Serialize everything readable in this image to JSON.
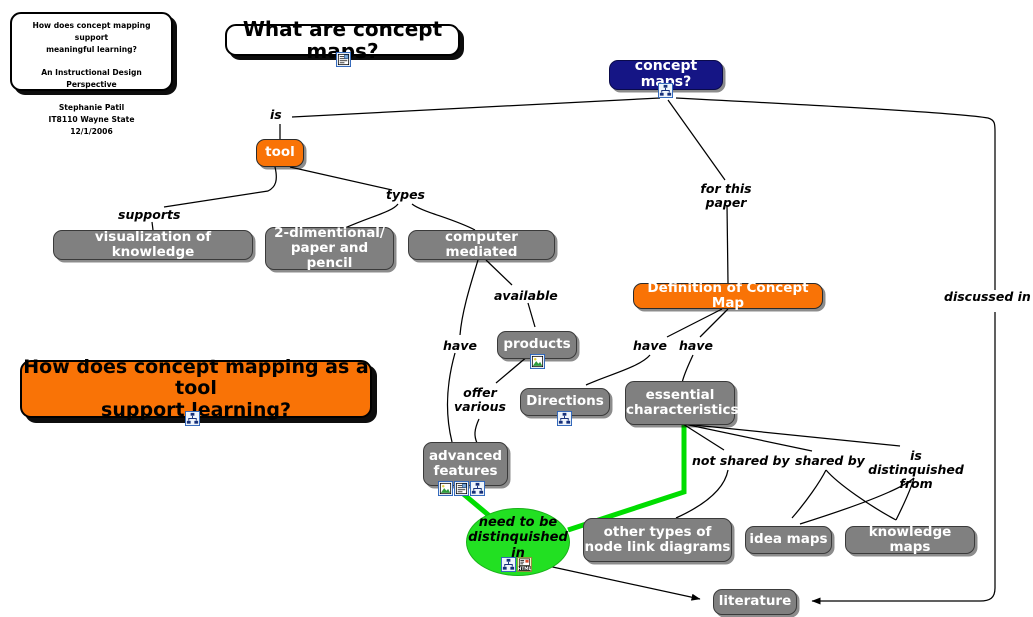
{
  "document": {
    "type": "concept-map",
    "background": "#ffffff"
  },
  "colors": {
    "grey_node": "#808080",
    "orange_node": "#f97306",
    "navy_node": "#151585",
    "green_ellipse": "#22e022",
    "green_link": "#00dd00",
    "white_node": "#ffffff",
    "text_on_grey": "#ffffff",
    "line": "#000000"
  },
  "title_card": {
    "line1": "How does concept mapping support",
    "line2": "meaningful learning?",
    "line3": "An Instructional Design Perspective",
    "line4": "Stephanie Patil",
    "line5": "IT8110 Wayne State",
    "line6": "12/1/2006"
  },
  "nodes": [
    {
      "id": "what-are-concept-maps",
      "label": "What are concept maps?",
      "style": "white",
      "icons": [
        "document-icon"
      ]
    },
    {
      "id": "concept-maps",
      "label": "concept maps?",
      "style": "navy",
      "icons": [
        "concept-map-icon"
      ]
    },
    {
      "id": "tool",
      "label": "tool",
      "style": "orange",
      "icons": []
    },
    {
      "id": "visualization-of-knowledge",
      "label": "visualization of knowledge",
      "style": "grey",
      "icons": []
    },
    {
      "id": "2-dimentional-paper-and-pencil",
      "label": "2-dimentional/ paper and pencil",
      "style": "grey",
      "icons": []
    },
    {
      "id": "computer-mediated",
      "label": "computer mediated",
      "style": "grey",
      "icons": []
    },
    {
      "id": "products",
      "label": "products",
      "style": "grey",
      "icons": [
        "image-icon"
      ]
    },
    {
      "id": "advanced-features",
      "label": "advanced features",
      "style": "grey",
      "icons": [
        "image-icon",
        "document-icon",
        "concept-map-icon"
      ]
    },
    {
      "id": "definition-of-concept-map",
      "label": "Definition of Concept Map",
      "style": "orange",
      "icons": []
    },
    {
      "id": "directions",
      "label": "Directions",
      "style": "grey",
      "icons": [
        "concept-map-icon"
      ]
    },
    {
      "id": "essential-characteristics",
      "label": "essential characteristics",
      "style": "grey",
      "icons": []
    },
    {
      "id": "need-to-be-distinquished-in",
      "label": "need to be distinquished in",
      "style": "green-ellipse",
      "icons": [
        "concept-map-icon",
        "html-icon"
      ]
    },
    {
      "id": "other-types-of-node-link-diagrams",
      "label": "other types of node link diagrams",
      "style": "grey",
      "icons": []
    },
    {
      "id": "idea-maps",
      "label": "idea maps",
      "style": "grey",
      "icons": []
    },
    {
      "id": "knowledge-maps",
      "label": "knowledge maps",
      "style": "grey",
      "icons": []
    },
    {
      "id": "literature",
      "label": "literature",
      "style": "grey",
      "icons": []
    },
    {
      "id": "how-does-concept-mapping-as-a-tool",
      "label": "How does concept mapping as a tool support learning?",
      "style": "big-orange",
      "icons": [
        "concept-map-icon"
      ]
    }
  ],
  "node_labels": {
    "what_are_concept_maps": "What are concept maps?",
    "concept_maps": "concept maps?",
    "tool": "tool",
    "visualization_of_knowledge": "visualization of knowledge",
    "two_dimentional_line1": "2-dimentional/",
    "two_dimentional_line2": "paper and pencil",
    "computer_mediated": "computer mediated",
    "products": "products",
    "advanced_features_line1": "advanced",
    "advanced_features_line2": "features",
    "definition_of_concept_map": "Definition of Concept Map",
    "directions": "Directions",
    "essential_line1": "essential",
    "essential_line2": "characteristics",
    "need_line1": "need to be",
    "need_line2": "distinquished",
    "need_line3": "in",
    "other_types_line1": "other types of",
    "other_types_line2": "node link diagrams",
    "idea_maps": "idea maps",
    "knowledge_maps": "knowledge maps",
    "literature": "literature",
    "big_question_line1": "How does concept mapping as a tool",
    "big_question_line2": "support learning?"
  },
  "link_phrases": {
    "is": "is",
    "supports": "supports",
    "types": "types",
    "available": "available",
    "have_left": "have",
    "offer_various_line1": "offer",
    "offer_various_line2": "various",
    "for_this_paper_line1": "for this",
    "for_this_paper_line2": "paper",
    "have_directions": "have",
    "have_essential": "have",
    "not_shared_by": "not shared by",
    "shared_by": "shared by",
    "is_distinquished_from_line1": "is distinquished",
    "is_distinquished_from_line2": "from",
    "discussed_in": "discussed in"
  },
  "propositions": [
    {
      "from": "concept maps?",
      "phrase": "is",
      "to": "tool"
    },
    {
      "from": "tool",
      "phrase": "supports",
      "to": "visualization of knowledge"
    },
    {
      "from": "tool",
      "phrase": "types",
      "to": "2-dimentional/ paper and pencil"
    },
    {
      "from": "tool",
      "phrase": "types",
      "to": "computer mediated"
    },
    {
      "from": "computer mediated",
      "phrase": "available",
      "to": "products"
    },
    {
      "from": "computer mediated",
      "phrase": "have",
      "to": "advanced features"
    },
    {
      "from": "products",
      "phrase": "offer various",
      "to": "advanced features"
    },
    {
      "from": "concept maps?",
      "phrase": "for this paper",
      "to": "Definition of Concept Map"
    },
    {
      "from": "Definition of Concept Map",
      "phrase": "have",
      "to": "Directions"
    },
    {
      "from": "Definition of Concept Map",
      "phrase": "have",
      "to": "essential characteristics"
    },
    {
      "from": "advanced features",
      "phrase": "",
      "to": "need to be distinquished in"
    },
    {
      "from": "essential characteristics",
      "phrase": "",
      "to": "need to be distinquished in"
    },
    {
      "from": "essential characteristics",
      "phrase": "not shared by",
      "to": "other types of node link diagrams"
    },
    {
      "from": "essential characteristics",
      "phrase": "shared by",
      "to": "idea maps"
    },
    {
      "from": "essential characteristics",
      "phrase": "shared by",
      "to": "knowledge maps"
    },
    {
      "from": "essential characteristics",
      "phrase": "is distinquished from",
      "to": "idea maps"
    },
    {
      "from": "essential characteristics",
      "phrase": "is distinquished from",
      "to": "knowledge maps"
    },
    {
      "from": "need to be distinquished in",
      "phrase": "",
      "to": "literature"
    },
    {
      "from": "concept maps?",
      "phrase": "discussed in",
      "to": "literature"
    }
  ]
}
